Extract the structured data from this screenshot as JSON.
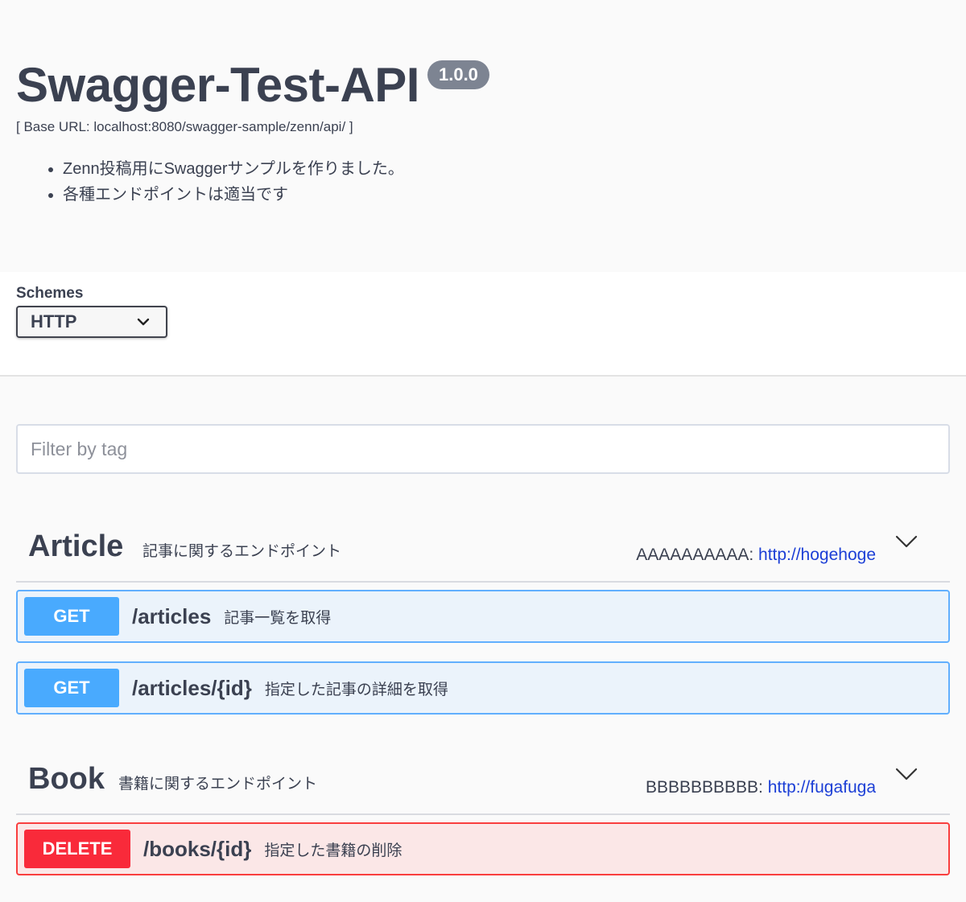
{
  "info": {
    "title": "Swagger-Test-API",
    "version": "1.0.0",
    "base_url": "[ Base URL: localhost:8080/swagger-sample/zenn/api/ ]",
    "description_items": [
      "Zenn投稿用にSwaggerサンプルを作りました。",
      "各種エンドポイントは適当です"
    ]
  },
  "schemes": {
    "label": "Schemes",
    "selected": "HTTP"
  },
  "filter": {
    "placeholder": "Filter by tag"
  },
  "tags": [
    {
      "name": "Article",
      "description": "記事に関するエンドポイント",
      "external_label": "AAAAAAAAAA:",
      "external_url": "http://hogehoge",
      "operations": [
        {
          "method": "GET",
          "path": "/articles",
          "summary": "記事一覧を取得"
        },
        {
          "method": "GET",
          "path": "/articles/{id}",
          "summary": "指定した記事の詳細を取得"
        }
      ]
    },
    {
      "name": "Book",
      "description": "書籍に関するエンドポイント",
      "external_label": "BBBBBBBBBB:",
      "external_url": "http://fugafuga",
      "operations": [
        {
          "method": "DELETE",
          "path": "/books/{id}",
          "summary": "指定した書籍の削除"
        }
      ]
    }
  ],
  "colors": {
    "get": "#49aafe",
    "delete": "#f92a3a",
    "text": "#3b4151",
    "link": "#1c3fd6"
  },
  "icons": {
    "schemes_select": "chevron-down-icon",
    "tag_toggle": "chevron-down-icon"
  }
}
